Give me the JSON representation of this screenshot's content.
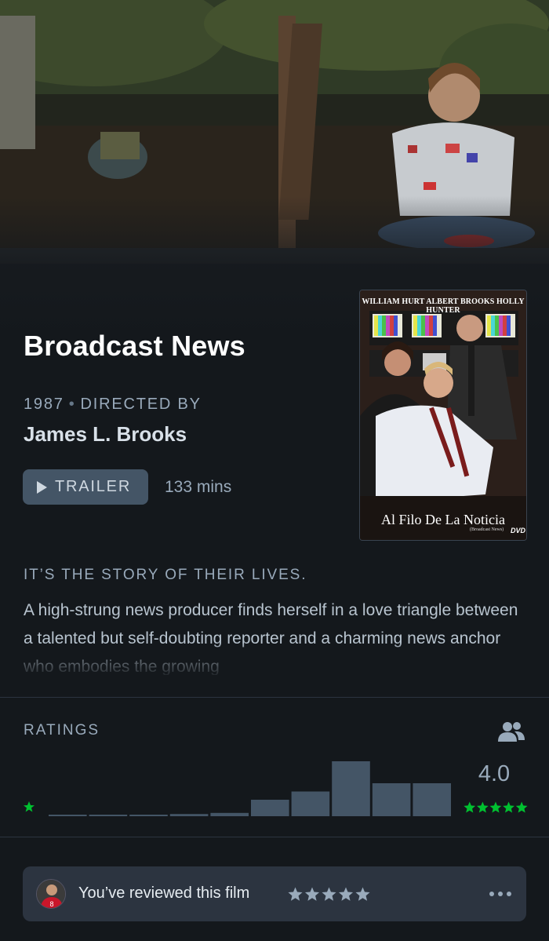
{
  "film": {
    "title": "Broadcast News",
    "year": "1987",
    "directed_by_label": "DIRECTED BY",
    "director": "James L. Brooks",
    "trailer_label": "TRAILER",
    "runtime": "133 mins",
    "tagline": "IT’S THE STORY OF THEIR LIVES.",
    "synopsis": "A high-strung news producer finds herself in a love triangle between a talented but self-doubting reporter and a charming news anchor who embodies the growing"
  },
  "poster": {
    "cast_line": "WILLIAM HURT   ALBERT BROOKS   HOLLY HUNTER",
    "title": "Al Filo De La Noticia",
    "subtitle": "(Broadcast News)",
    "format": "DVD"
  },
  "ratings": {
    "label": "RATINGS",
    "average": "4.0",
    "histogram": [
      0.02,
      0.02,
      0.02,
      0.04,
      0.06,
      0.3,
      0.45,
      1.0,
      0.6,
      0.6
    ],
    "min_stars": 1,
    "max_stars": 5
  },
  "review": {
    "text": "You’ve reviewed this film",
    "user_stars": 5
  },
  "colors": {
    "background": "#14181c",
    "histogram_bar": "#445566",
    "accent_green": "#00c030",
    "muted_text": "#99aabb"
  },
  "icons": [
    "play-icon",
    "friends-icon",
    "star-icon",
    "more-icon"
  ]
}
